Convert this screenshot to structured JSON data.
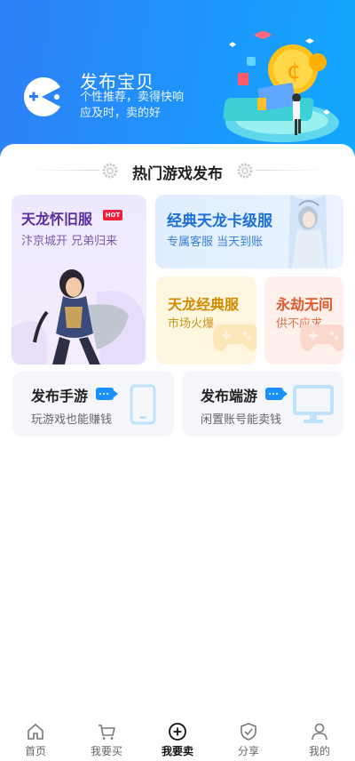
{
  "banner": {
    "title": "发布宝贝",
    "subtitle": "个性推荐，卖得快响应及时，卖的好",
    "logo_icon": "pacman-icon",
    "illustration": "coin-ocean-illustration",
    "colors": {
      "start": "#2f7ff6",
      "end": "#12a9ff"
    }
  },
  "section": {
    "title": "热门游戏发布"
  },
  "cards": [
    {
      "title": "天龙怀旧服",
      "badge": "HOT",
      "subtitle": "汴京城开 兄弟归来",
      "title_color": "#5a2d9c"
    },
    {
      "title": "经典天龙卡级服",
      "subtitle": "专属客服 当天到账",
      "title_color": "#1e6fd6"
    },
    {
      "title": "天龙经典服",
      "subtitle": "市场火爆",
      "title_color": "#d08a00"
    },
    {
      "title": "永劫无间",
      "subtitle": "供不应求",
      "title_color": "#e05a2a"
    }
  ],
  "publish": [
    {
      "title": "发布手游",
      "subtitle": "玩游戏也能赚钱",
      "icon": "phone-icon"
    },
    {
      "title": "发布端游",
      "subtitle": "闲置账号能卖钱",
      "icon": "monitor-icon"
    }
  ],
  "tabs": [
    {
      "label": "首页",
      "icon": "home-icon"
    },
    {
      "label": "我要买",
      "icon": "cart-icon"
    },
    {
      "label": "我要卖",
      "icon": "plus-circle-icon",
      "active": true
    },
    {
      "label": "分享",
      "icon": "shield-icon"
    },
    {
      "label": "我的",
      "icon": "user-icon"
    }
  ]
}
